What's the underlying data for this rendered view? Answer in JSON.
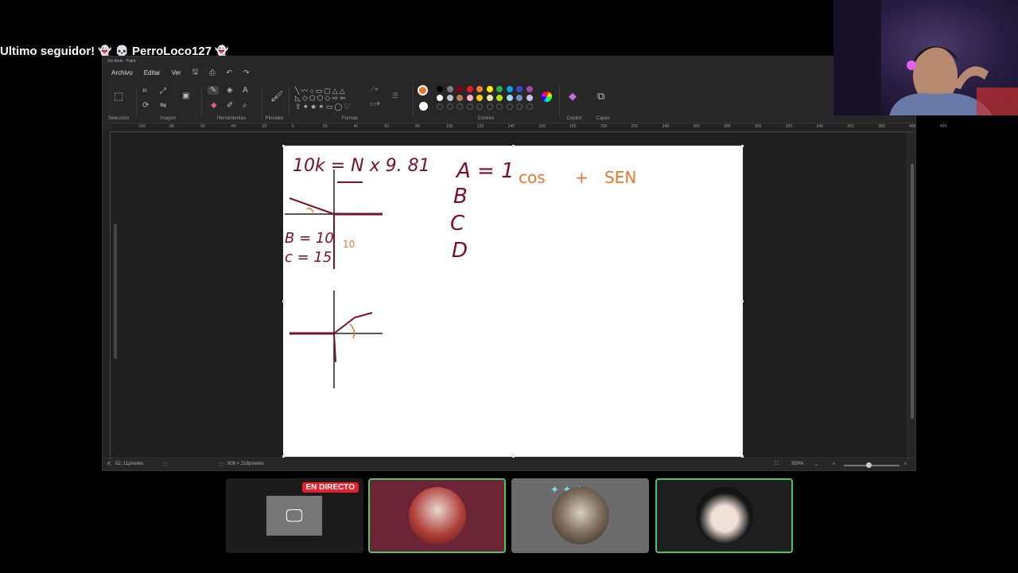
{
  "alert": {
    "text": "Ultimo seguidor!",
    "username": "PerroLoco127",
    "ghost_icon": "ghost-icon",
    "skull_icon": "skull-icon"
  },
  "paint": {
    "title": "Sin título - Paint",
    "menu": [
      "Archivo",
      "Editar",
      "Ver"
    ],
    "groups": {
      "seleccion": "Selección",
      "imagen": "Imagen",
      "herramientas": "Herramientas",
      "pinceles": "Pinceles",
      "formas": "Formas",
      "colores": "Colores",
      "copilot": "Copilot",
      "capas": "Capas"
    },
    "ruler_labels": [
      "-100",
      "-80",
      "-60",
      "-40",
      "-20",
      "0",
      "20",
      "40",
      "60",
      "80",
      "100",
      "120",
      "140",
      "160",
      "180",
      "200",
      "220",
      "240",
      "260",
      "280",
      "300",
      "320",
      "340",
      "360",
      "380",
      "400",
      "420"
    ],
    "status": {
      "cursor": "52, 11píxeles",
      "size": "509 × 218píxeles",
      "zoom": "350%"
    },
    "colors": {
      "primary": "#e8762c",
      "secondary": "#ffffff",
      "palette_row1": [
        "#000000",
        "#7f7f7f",
        "#880015",
        "#ed1c24",
        "#ff7f27",
        "#fff200",
        "#22b14c",
        "#00a2e8",
        "#3f48cc",
        "#a349a4"
      ],
      "palette_row2": [
        "#ffffff",
        "#c3c3c3",
        "#b97a57",
        "#ffaec9",
        "#ffc90e",
        "#efe4b0",
        "#b5e61d",
        "#99d9ea",
        "#7092be",
        "#c8bfe7"
      ]
    }
  },
  "drawing": {
    "eq1": "10k = N x 9. 81",
    "eq2": "A = 1",
    "cos": "cos",
    "plus": "+",
    "sen": "SEN",
    "b": "B",
    "c": "C",
    "d": "D",
    "b_val": "B = 10",
    "c_val": "c = 15",
    "ten": "10"
  },
  "participants": {
    "live_label": "EN DIRECTO"
  }
}
